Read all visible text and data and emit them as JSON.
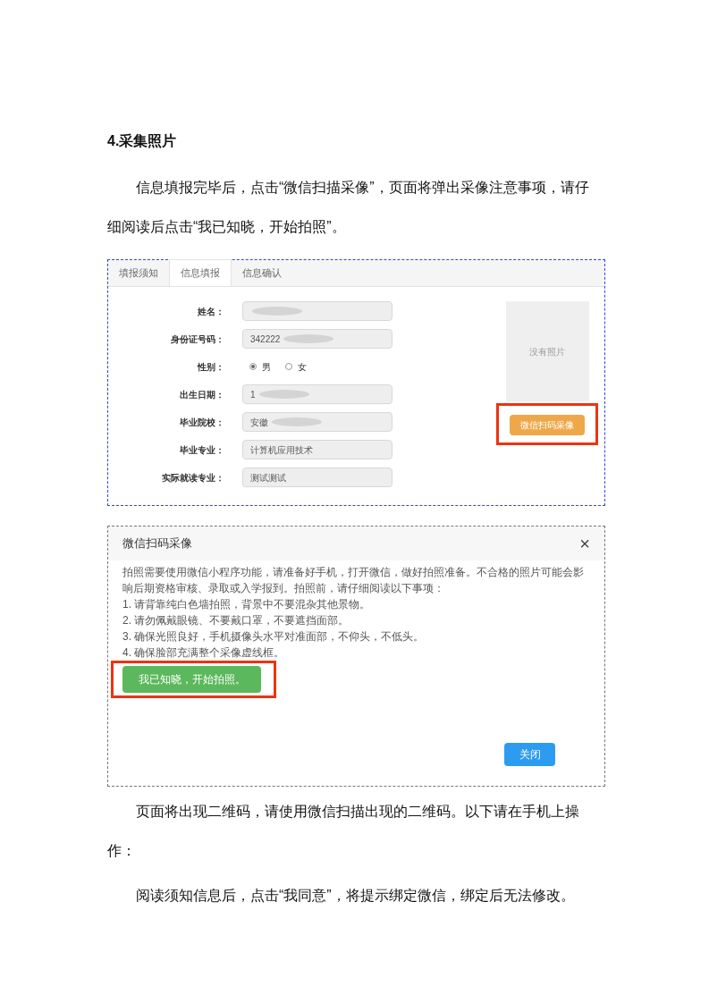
{
  "heading": "4.采集照片",
  "intro": [
    "信息填报完毕后，点击“微信扫描采像”，页面将弹出采像注意事项，请仔细阅读后点击“我已知晓，开始拍照”。"
  ],
  "form_screen": {
    "tabs": [
      {
        "label": "填报须知",
        "selected": false
      },
      {
        "label": "信息填报",
        "selected": true
      },
      {
        "label": "信息确认",
        "selected": false
      }
    ],
    "fields": [
      {
        "kind": "input",
        "label": "姓名：",
        "redacted": true
      },
      {
        "kind": "input",
        "label": "身份证号码：",
        "value": "342222",
        "redacted": true
      },
      {
        "kind": "radio",
        "label": "性别：",
        "options": [
          {
            "label": "男",
            "selected": true
          },
          {
            "label": "女",
            "selected": false
          }
        ]
      },
      {
        "kind": "input",
        "label": "出生日期：",
        "value": "1",
        "redacted": true
      },
      {
        "kind": "input",
        "label": "毕业院校：",
        "value": "安徽",
        "redacted": true
      },
      {
        "kind": "input",
        "label": "毕业专业：",
        "value": "计算机应用技术",
        "redacted": false
      },
      {
        "kind": "input",
        "label": "实际就读专业：",
        "value": "测试测试",
        "redacted": false
      }
    ],
    "photo_placeholder": "没有照片",
    "scan_button": "微信扫码采像"
  },
  "dialog": {
    "title": "微信扫码采像",
    "close": "×",
    "body": "拍照需要使用微信小程序功能，请准备好手机，打开微信，做好拍照准备。不合格的照片可能会影响后期资格审核、录取或入学报到。拍照前，请仔细阅读以下事项：",
    "items": [
      "1. 请背靠纯白色墙拍照，背景中不要混杂其他景物。",
      "2. 请勿佩戴眼镜、不要戴口罩，不要遮挡面部。",
      "3. 确保光照良好，手机摄像头水平对准面部，不仰头，不低头。",
      "4. 确保脸部充满整个采像虚线框。"
    ],
    "confirm_button": "我已知晓，开始拍照。",
    "close_button": "关闭"
  },
  "outro": [
    "页面将出现二维码，请使用微信扫描出现的二维码。以下请在手机上操作：",
    "阅读须知信息后，点击“我同意”，将提示绑定微信，绑定后无法修改。"
  ]
}
